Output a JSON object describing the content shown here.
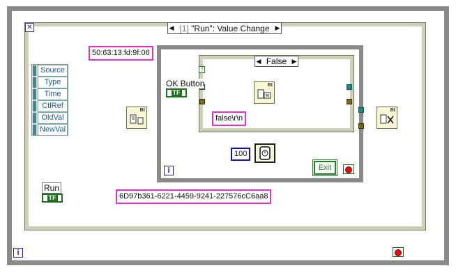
{
  "event_structure": {
    "close_glyph": "✕",
    "selector_index": "[1]",
    "selector_label": "\"Run\": Value Change",
    "left_arrow": "◀",
    "right_arrow": "▶"
  },
  "event_data_node": {
    "fields": [
      "Source",
      "Type",
      "Time",
      "CtlRef",
      "OldVal",
      "NewVal"
    ]
  },
  "constants": {
    "mac_address": "50:63:13:fd:9f:06",
    "uuid": "6D97b361-6221-4459-9241-227576cC6aa8",
    "false_string": "false\\r\\n",
    "wait_ms": "100"
  },
  "case_structure": {
    "selector_label": "False",
    "left_arrow": "◀",
    "right_arrow": "▶",
    "boolean_selector_glyph": "?"
  },
  "controls": {
    "ok_button_label": "OK Button",
    "run_label": "Run",
    "exit_label": "Exit",
    "bool_tag": "TF"
  },
  "vi_icons": {
    "bt_label": "Bt"
  },
  "iteration_terminal": "i",
  "colors": {
    "string_wire": "#e032c8",
    "boolean_wire": "#1f7f1f",
    "refnum_wire": "#1f8a8a",
    "cluster_wire": "#7a6a1a",
    "loop_border": "#8a8a8a",
    "frame_border": "#cfcfb8"
  }
}
